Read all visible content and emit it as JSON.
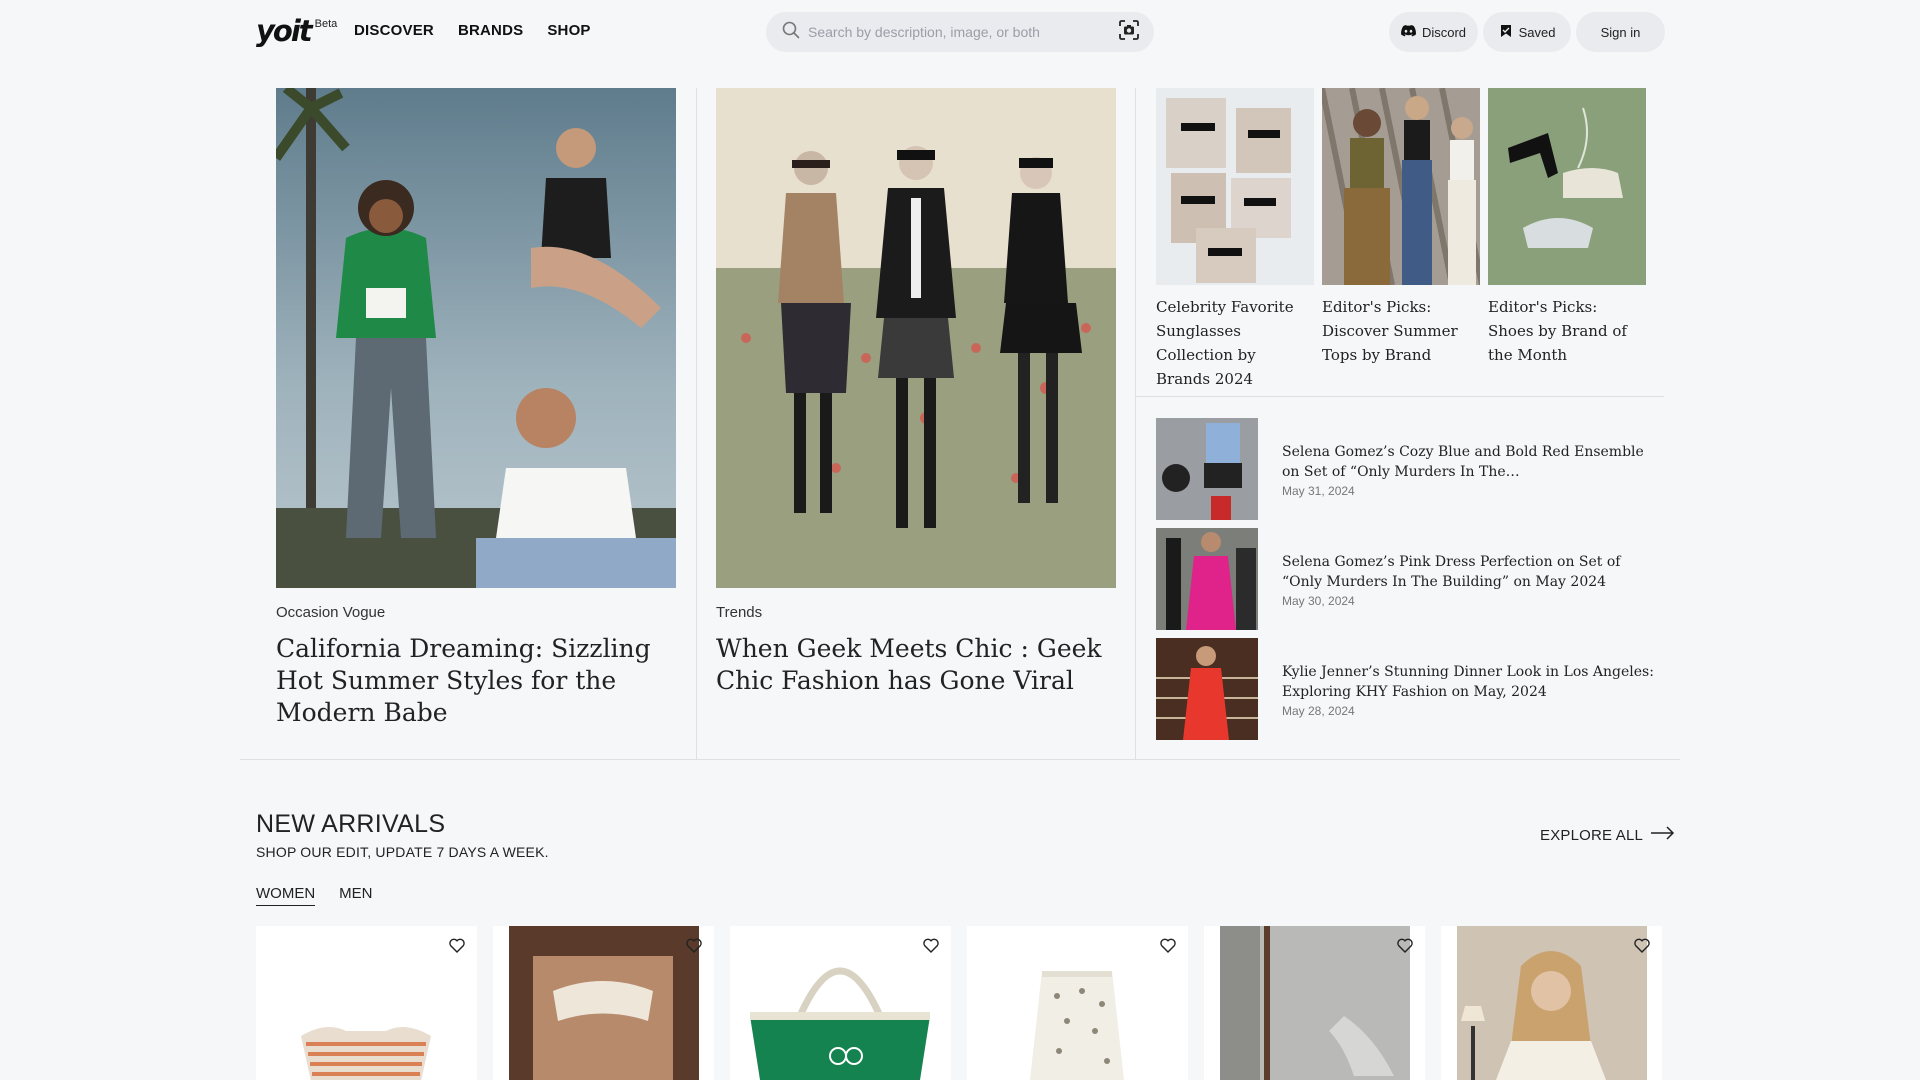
{
  "brand": {
    "logo_text": "yoit",
    "beta_label": "Beta"
  },
  "nav": {
    "items": [
      "DISCOVER",
      "BRANDS",
      "SHOP"
    ]
  },
  "search": {
    "placeholder": "Search by description, image, or both"
  },
  "header_actions": {
    "discord_label": "Discord",
    "saved_label": "Saved",
    "signin_label": "Sign in"
  },
  "featured": {
    "articles": [
      {
        "category": "Occasion Vogue",
        "headline": "California Dreaming: Sizzling Hot Summer Styles for the Modern Babe"
      },
      {
        "category": "Trends",
        "headline": "When Geek Meets Chic : Geek Chic Fashion has Gone Viral"
      }
    ],
    "picks": [
      {
        "title": "Celebrity Favorite Sunglasses Collection by Brands 2024"
      },
      {
        "title": "Editor's Picks: Discover Summer Tops by Brand"
      },
      {
        "title": "Editor's Picks: Shoes by Brand of the Month"
      }
    ],
    "news": [
      {
        "title": "Selena Gomez’s Cozy Blue and Bold Red Ensemble on Set of “Only Murders In The…",
        "date": "May 31, 2024"
      },
      {
        "title": "Selena Gomez’s Pink Dress Perfection on Set of “Only Murders In The Building” on May 2024",
        "date": "May 30, 2024"
      },
      {
        "title": "Kylie Jenner’s Stunning Dinner Look in Los Angeles: Exploring KHY Fashion on May, 2024",
        "date": "May 28, 2024"
      }
    ]
  },
  "new_arrivals": {
    "title": "NEW ARRIVALS",
    "subtitle": "SHOP OUR EDIT, UPDATE 7 DAYS A WEEK.",
    "explore_label": "EXPLORE ALL",
    "tabs": [
      "WOMEN",
      "MEN"
    ],
    "active_tab": "WOMEN"
  },
  "colors": {
    "background": "#f6f7f9",
    "pill": "#e9ebee",
    "divider": "#dde0e4",
    "text": "#222222"
  }
}
